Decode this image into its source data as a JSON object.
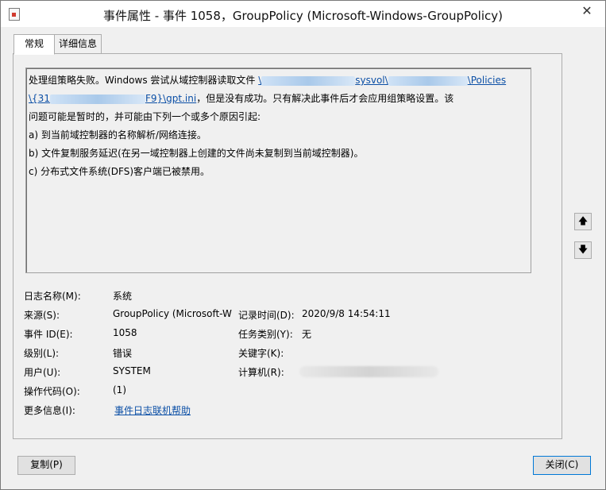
{
  "window": {
    "title": "事件属性 - 事件 1058，GroupPolicy (Microsoft-Windows-GroupPolicy)",
    "close_glyph": "✕"
  },
  "tabs": [
    {
      "label": "常规",
      "active": true
    },
    {
      "label": "详细信息",
      "active": false
    }
  ],
  "description": {
    "line1_prefix": "处理组策略失败。Windows 尝试从域控制器读取文件 ",
    "link_part1": "\\",
    "link_part2": "sysvol\\",
    "link_part3": "\\Policies",
    "link_part4": "\\{31",
    "link_part5": "F9}\\gpt.ini",
    "line2_suffix": "，但是没有成功。只有解决此事件后才会应用组策略设置。该",
    "line3": "问题可能是暂时的，并可能由下列一个或多个原因引起:",
    "line4": "a) 到当前域控制器的名称解析/网络连接。",
    "line5": "b) 文件复制服务延迟(在另一域控制器上创建的文件尚未复制到当前域控制器)。",
    "line6": "c) 分布式文件系统(DFS)客户端已被禁用。"
  },
  "nav": {
    "up_glyph": "🡅",
    "down_glyph": "🡇"
  },
  "fields": {
    "log_name_label": "日志名称(M):",
    "log_name_value": "系统",
    "source_label": "来源(S):",
    "source_value": "GroupPolicy (Microsoft-W",
    "logged_label": "记录时间(D):",
    "logged_value": "2020/9/8 14:54:11",
    "event_id_label": "事件 ID(E):",
    "event_id_value": "1058",
    "task_category_label": "任务类别(Y):",
    "task_category_value": "无",
    "level_label": "级别(L):",
    "level_value": "错误",
    "keywords_label": "关键字(K):",
    "user_label": "用户(U):",
    "user_value": "SYSTEM",
    "computer_label": "计算机(R):",
    "opcode_label": "操作代码(O):",
    "opcode_value": "(1)",
    "more_info_label": "更多信息(I):",
    "more_info_link": "事件日志联机帮助"
  },
  "buttons": {
    "copy": "复制(P)",
    "close": "关闭(C)"
  }
}
